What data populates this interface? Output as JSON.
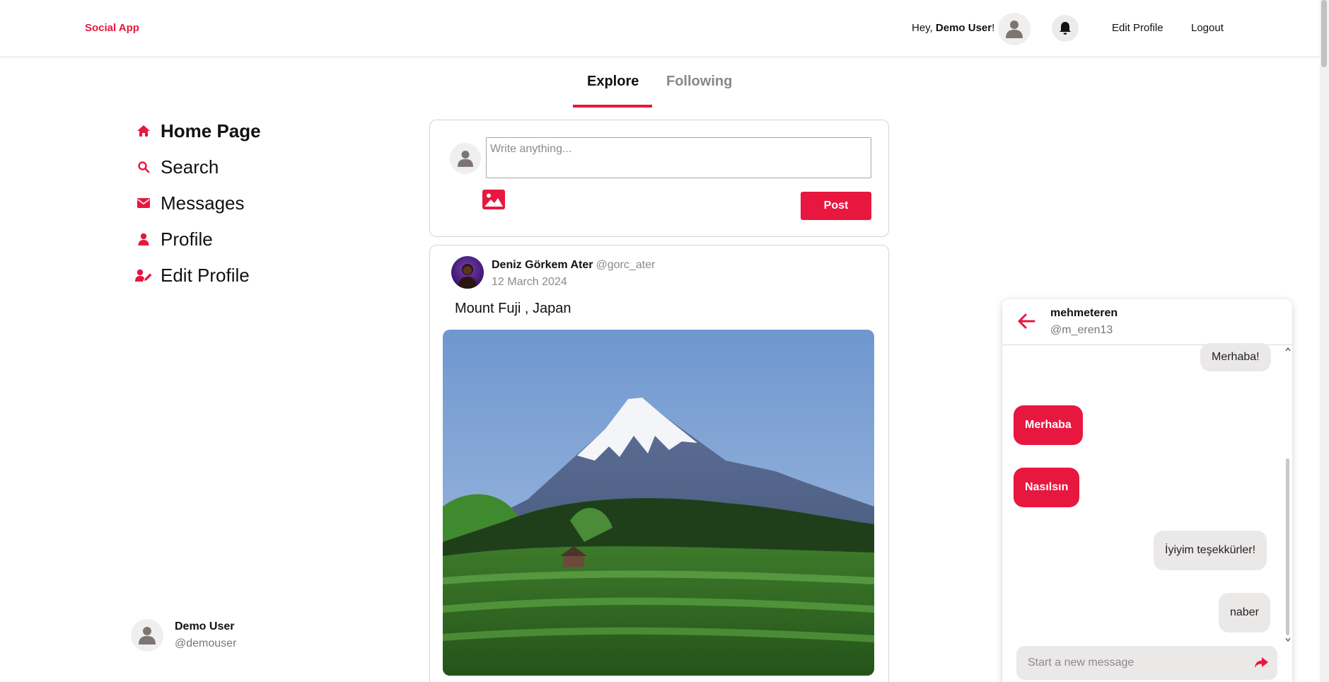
{
  "app": {
    "brand": "Social App"
  },
  "header": {
    "greeting_prefix": "Hey, ",
    "user_name": "Demo User",
    "greeting_suffix": "!",
    "edit_profile": "Edit Profile",
    "logout": "Logout"
  },
  "tabs": [
    {
      "label": "Explore",
      "active": true
    },
    {
      "label": "Following",
      "active": false
    }
  ],
  "sidebar": {
    "items": [
      {
        "label": "Home Page",
        "icon": "home-icon",
        "active": true
      },
      {
        "label": "Search",
        "icon": "search-icon",
        "active": false
      },
      {
        "label": "Messages",
        "icon": "envelope-icon",
        "active": false
      },
      {
        "label": "Profile",
        "icon": "user-icon",
        "active": false
      },
      {
        "label": "Edit Profile",
        "icon": "user-edit-icon",
        "active": false
      }
    ],
    "current_user": {
      "name": "Demo User",
      "handle": "@demouser"
    }
  },
  "composer": {
    "placeholder": "Write anything...",
    "value": "",
    "post_label": "Post"
  },
  "feed": [
    {
      "author": "Deniz Görkem Ater",
      "handle": "@gorc_ater",
      "date": "12 March 2024",
      "text": "Mount Fuji , Japan"
    }
  ],
  "chat": {
    "name": "mehmeteren",
    "handle": "@m_eren13",
    "messages": [
      {
        "text": "Merhaba!",
        "from": "them"
      },
      {
        "text": "Merhaba",
        "from": "me"
      },
      {
        "text": "Nasılsın",
        "from": "me"
      },
      {
        "text": "İyiyim teşekkürler!",
        "from": "them"
      },
      {
        "text": "naber",
        "from": "them"
      }
    ],
    "input_placeholder": "Start a new message",
    "input_value": ""
  },
  "colors": {
    "accent": "#e8173f",
    "bubble_in": "#ebe8e8",
    "muted": "#8a8a8a"
  }
}
